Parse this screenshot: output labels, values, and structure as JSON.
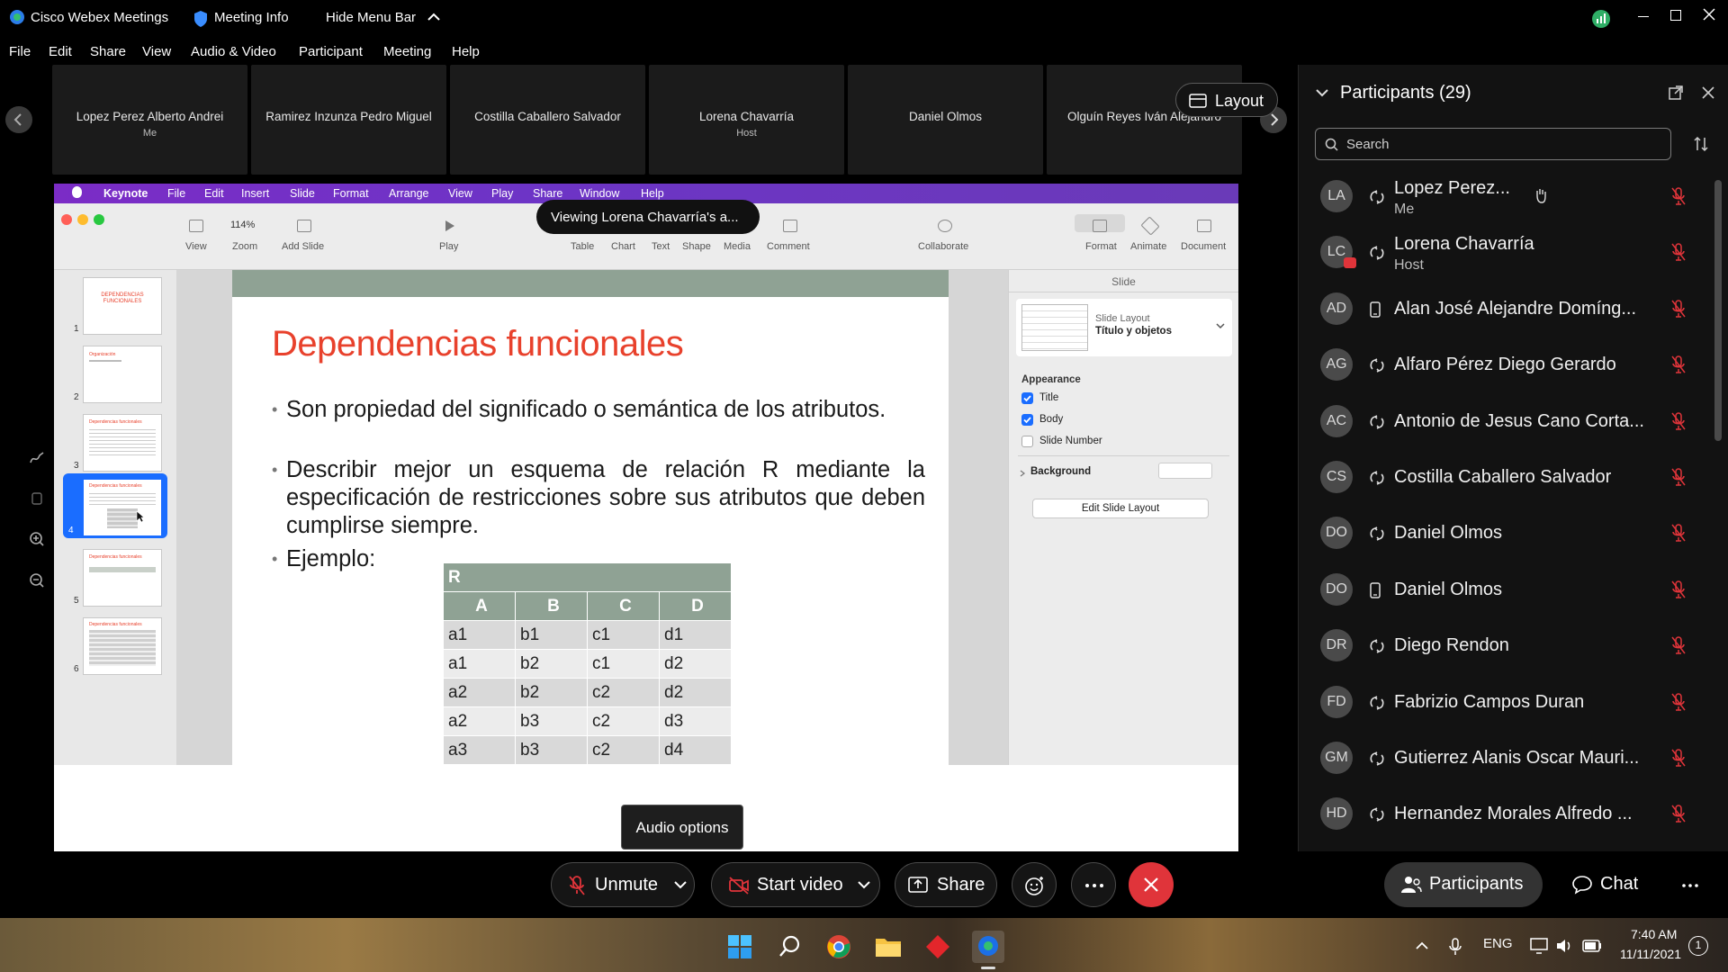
{
  "titlebar": {
    "app_name": "Cisco Webex Meetings",
    "meeting_info": "Meeting Info",
    "hide_menu_bar": "Hide Menu Bar"
  },
  "menu": {
    "file": "File",
    "edit": "Edit",
    "share": "Share",
    "view": "View",
    "audio_video": "Audio & Video",
    "participant": "Participant",
    "meeting": "Meeting",
    "help": "Help"
  },
  "strip": {
    "tiles": [
      {
        "name": "Lopez Perez Alberto Andrei",
        "sub": "Me"
      },
      {
        "name": "Ramirez Inzunza Pedro Miguel",
        "sub": ""
      },
      {
        "name": "Costilla Caballero Salvador",
        "sub": ""
      },
      {
        "name": "Lorena Chavarría",
        "sub": "Host"
      },
      {
        "name": "Daniel Olmos",
        "sub": ""
      },
      {
        "name": "Olguín Reyes Iván Alejandro",
        "sub": ""
      }
    ],
    "layout_label": "Layout"
  },
  "viewing_banner": "Viewing Lorena Chavarría's a...",
  "keynote": {
    "menu": [
      "Keynote",
      "File",
      "Edit",
      "Insert",
      "Slide",
      "Format",
      "Arrange",
      "View",
      "Play",
      "Share",
      "Window",
      "Help"
    ],
    "zoom": "114%",
    "toolbar": {
      "view": "View",
      "zoom": "Zoom",
      "add_slide": "Add Slide",
      "play": "Play",
      "table": "Table",
      "chart": "Chart",
      "text": "Text",
      "shape": "Shape",
      "media": "Media",
      "comment": "Comment",
      "collaborate": "Collaborate",
      "format": "Format",
      "animate": "Animate",
      "document": "Document"
    },
    "thumbnail_numbers": [
      "1",
      "2",
      "3",
      "4",
      "5",
      "6"
    ],
    "thumbnail_titles": [
      "DEPENDENCIAS FUNCIONALES",
      "Organización",
      "Dependencias funcionales",
      "Dependencias funcionales",
      "Dependencias funcionales",
      "Dependencias funcionales"
    ],
    "slide": {
      "title": "Dependencias funcionales",
      "bullets": [
        "Son propiedad del significado o semántica de los atributos.",
        "Describir mejor un esquema de relación R mediante la especificación de restricciones sobre sus atributos que deben cumplirse siempre.",
        "Ejemplo:"
      ],
      "table": {
        "relation": "R",
        "headers": [
          "A",
          "B",
          "C",
          "D"
        ],
        "rows": [
          [
            "a1",
            "b1",
            "c1",
            "d1"
          ],
          [
            "a1",
            "b2",
            "c1",
            "d2"
          ],
          [
            "a2",
            "b2",
            "c2",
            "d2"
          ],
          [
            "a2",
            "b3",
            "c2",
            "d3"
          ],
          [
            "a3",
            "b3",
            "c2",
            "d4"
          ]
        ]
      }
    },
    "inspector": {
      "heading": "Slide",
      "layout_label": "Slide Layout",
      "layout_value": "Título y objetos",
      "appearance": "Appearance",
      "title_cb": "Title",
      "body_cb": "Body",
      "slide_number_cb": "Slide Number",
      "background": "Background",
      "edit_layout": "Edit Slide Layout",
      "title_checked": true,
      "body_checked": true,
      "slide_number_checked": false
    }
  },
  "audio_tooltip": "Audio options",
  "participants": {
    "title": "Participants (29)",
    "search_placeholder": "Search",
    "list": [
      {
        "initials": "LA",
        "name": "Lopez Perez...",
        "role": "Me",
        "device": "sync"
      },
      {
        "initials": "LC",
        "name": "Lorena Chavarría",
        "role": "Host",
        "device": "sync"
      },
      {
        "initials": "AD",
        "name": "Alan José Alejandre Domíng...",
        "role": "",
        "device": "phone"
      },
      {
        "initials": "AG",
        "name": "Alfaro Pérez Diego Gerardo",
        "role": "",
        "device": "sync"
      },
      {
        "initials": "AC",
        "name": "Antonio de Jesus Cano Corta...",
        "role": "",
        "device": "sync"
      },
      {
        "initials": "CS",
        "name": "Costilla Caballero Salvador",
        "role": "",
        "device": "sync"
      },
      {
        "initials": "DO",
        "name": "Daniel Olmos",
        "role": "",
        "device": "sync"
      },
      {
        "initials": "DO",
        "name": "Daniel Olmos",
        "role": "",
        "device": "phone"
      },
      {
        "initials": "DR",
        "name": "Diego Rendon",
        "role": "",
        "device": "sync"
      },
      {
        "initials": "FD",
        "name": "Fabrizio Campos Duran",
        "role": "",
        "device": "sync"
      },
      {
        "initials": "GM",
        "name": "Gutierrez Alanis Oscar Mauri...",
        "role": "",
        "device": "sync"
      },
      {
        "initials": "HD",
        "name": "Hernandez Morales Alfredo ...",
        "role": "",
        "device": "sync"
      }
    ]
  },
  "controls": {
    "unmute": "Unmute",
    "start_video": "Start video",
    "share": "Share",
    "participants": "Participants",
    "chat": "Chat"
  },
  "taskbar": {
    "lang": "ENG",
    "time": "7:40 AM",
    "date": "11/11/2021",
    "notifications": "1"
  },
  "colors": {
    "leave_red": "#e0343a",
    "muted_red": "#e0343a",
    "keynote_purple": "#7b2cc6",
    "slide_title_red": "#e8412c",
    "table_header": "#8fa294",
    "selection_blue": "#1a6dff"
  }
}
